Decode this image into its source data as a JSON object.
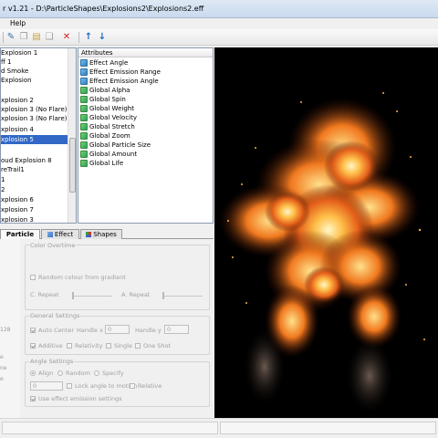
{
  "window": {
    "title": "r v1.21 - D:\\ParticleShapes\\Explosions2\\Explosions2.eff"
  },
  "menu": {
    "help": "Help"
  },
  "toolbar": {
    "icons": [
      "tool-icon",
      "copy-icon",
      "paste-icon",
      "clone-icon",
      "delete-icon",
      "move-up-icon",
      "move-down-icon"
    ]
  },
  "emitters": [
    {
      "label": "Explosion 1"
    },
    {
      "label": "ff 1"
    },
    {
      "label": "d Smoke"
    },
    {
      "label": "Explosion"
    },
    {
      "label": ""
    },
    {
      "label": "xplosion 2"
    },
    {
      "label": "xplosion 3 (No Flare) a"
    },
    {
      "label": "xplosion 3 (No Flare) b"
    },
    {
      "label": "xplosion 4"
    },
    {
      "label": "xplosion 5",
      "selected": true
    },
    {
      "label": ""
    },
    {
      "label": "oud Explosion 8"
    },
    {
      "label": "reTrail1"
    },
    {
      "label": "1"
    },
    {
      "label": "2"
    },
    {
      "label": "xplosion 6"
    },
    {
      "label": "xplosion 7"
    },
    {
      "label": "xplosion 3"
    }
  ],
  "attributes": {
    "header": "Attributes",
    "items": [
      {
        "label": "Effect Angle",
        "icon": "blue"
      },
      {
        "label": "Effect Emission Range",
        "icon": "blue"
      },
      {
        "label": "Effect Emission Angle",
        "icon": "blue"
      },
      {
        "label": "Global Alpha",
        "icon": "green"
      },
      {
        "label": "Global Spin",
        "icon": "green"
      },
      {
        "label": "Global Weight",
        "icon": "green"
      },
      {
        "label": "Global Velocity",
        "icon": "green"
      },
      {
        "label": "Global Stretch",
        "icon": "green"
      },
      {
        "label": "Global Zoom",
        "icon": "green"
      },
      {
        "label": "Global Particle Size",
        "icon": "green"
      },
      {
        "label": "Global Amount",
        "icon": "green"
      },
      {
        "label": "Global Life",
        "icon": "green"
      }
    ]
  },
  "tabs": {
    "particle": "Particle",
    "effect": "Effect",
    "shapes": "Shapes"
  },
  "left_strip": {
    "a": "128",
    "b": "e",
    "c": "ne",
    "d": "e"
  },
  "color_overtime": {
    "legend": "Color Overtime",
    "random_colour": "Random colour from gradient",
    "c_repeat": "C. Repeat",
    "a_repeat": "A. Repeat"
  },
  "general_settings": {
    "legend": "General Settings",
    "auto_center": "Auto Center",
    "handle_x": "Handle x",
    "handle_x_value": "0",
    "handle_y": "Handle y",
    "handle_y_value": "0",
    "additive": "Additive",
    "relativity": "Relativity",
    "single": "Single",
    "one_shot": "One Shot"
  },
  "angle_settings": {
    "legend": "Angle Settings",
    "align": "Align",
    "random": "Random",
    "specify": "Specify",
    "angle_value": "0",
    "lock_angle": "Lock angle to motion",
    "relative": "Relative",
    "use_effect_emission": "Use effect emission settings"
  },
  "colors": {
    "selection": "#3168c6",
    "attr_green": "#3ea84e",
    "attr_blue": "#3a8fd0",
    "preview_bg": "#000000"
  }
}
